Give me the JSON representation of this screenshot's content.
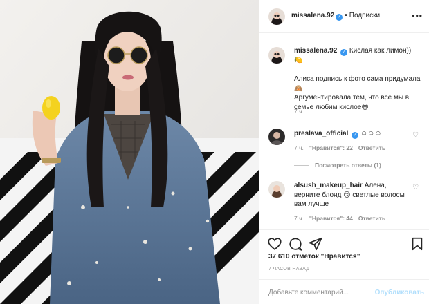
{
  "post": {
    "username": "missalena.92",
    "follow_label": "Подписки",
    "caption_line1": "Кислая как лимон))",
    "caption_emoji": "🍋",
    "caption_line2": "Алиса подпись к фото сама придумала🙈",
    "caption_line3": "Аргументировала тем, что все мы в семье любим кислое😅",
    "caption_time": "7 ч."
  },
  "comments": [
    {
      "username": "preslava_official",
      "text": "☺☺☺",
      "time": "7 ч.",
      "likes": "\"Нравится\": 22",
      "reply": "Ответить",
      "view_replies": "Посмотреть ответы (1)"
    },
    {
      "username": "alsush_makeup_hair",
      "text": "Алена, верните блонд 😕 светлые волосы вам лучше",
      "time": "7 ч.",
      "likes": "\"Нравится\": 44",
      "reply": "Ответить"
    }
  ],
  "footer": {
    "likes_count": "37 610 отметок \"Нравится\"",
    "post_time": "7 ЧАСОВ НАЗАД",
    "comment_placeholder": "Добавьте комментарий...",
    "publish_label": "Опубликовать"
  },
  "icons": {
    "like": "heart-icon",
    "comment": "comment-icon",
    "share": "share-icon",
    "save": "bookmark-icon",
    "more": "more-icon"
  },
  "colors": {
    "verified": "#3897f0",
    "text": "#262626",
    "muted": "#8e8e8e",
    "publish_disabled": "#b2dffc"
  }
}
